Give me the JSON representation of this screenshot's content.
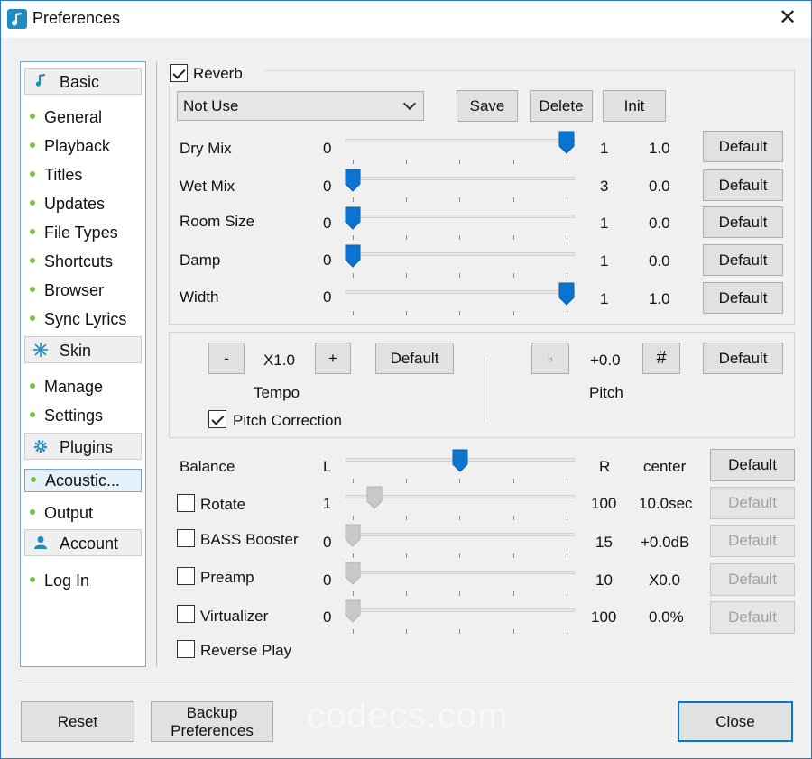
{
  "window": {
    "title": "Preferences",
    "close_glyph": "✕"
  },
  "sidebar": {
    "groups": [
      {
        "header": "Basic",
        "icon": "music-note-icon",
        "items": [
          "General",
          "Playback",
          "Titles",
          "Updates",
          "File Types",
          "Shortcuts",
          "Browser",
          "Sync Lyrics"
        ]
      },
      {
        "header": "Skin",
        "icon": "sparkle-icon",
        "items": [
          "Manage",
          "Settings"
        ]
      },
      {
        "header": "Plugins",
        "icon": "gear-icon",
        "items": [
          "Acoustic...",
          "Output"
        ]
      },
      {
        "header": "Account",
        "icon": "person-icon",
        "items": [
          "Log In"
        ]
      }
    ],
    "selected_item": "Acoustic..."
  },
  "reverb": {
    "label": "Reverb",
    "checked": true,
    "preset": "Not Use",
    "buttons": {
      "save": "Save",
      "delete": "Delete",
      "init": "Init"
    },
    "rows": [
      {
        "label": "Dry Mix",
        "min": "0",
        "max": "1",
        "value": "1.0",
        "level": 1.0,
        "button": "Default"
      },
      {
        "label": "Wet Mix",
        "min": "0",
        "max": "3",
        "value": "0.0",
        "level": 0.0,
        "button": "Default"
      },
      {
        "label": "Room Size",
        "min": "0",
        "max": "1",
        "value": "0.0",
        "level": 0.0,
        "button": "Default"
      },
      {
        "label": "Damp",
        "min": "0",
        "max": "1",
        "value": "0.0",
        "level": 0.0,
        "button": "Default"
      },
      {
        "label": "Width",
        "min": "0",
        "max": "1",
        "value": "1.0",
        "level": 1.0,
        "button": "Default"
      }
    ]
  },
  "tempo_pitch": {
    "tempo": {
      "minus": "-",
      "value": "X1.0",
      "plus": "+",
      "default": "Default",
      "label": "Tempo"
    },
    "pitch": {
      "flat": "♭",
      "value": "+0.0",
      "sharp": "#",
      "default": "Default",
      "label": "Pitch"
    },
    "pitch_correction": {
      "label": "Pitch Correction",
      "checked": true
    }
  },
  "effects": {
    "balance": {
      "label": "Balance",
      "min": "L",
      "max": "R",
      "value": "center",
      "level": 0.5,
      "button": "Default"
    },
    "rows": [
      {
        "label": "Rotate",
        "checked": false,
        "min": "1",
        "max": "100",
        "value": "10.0sec",
        "level": 0.1,
        "button": "Default"
      },
      {
        "label": "BASS Booster",
        "checked": false,
        "min": "0",
        "max": "15",
        "value": "+0.0dB",
        "level": 0.0,
        "button": "Default"
      },
      {
        "label": "Preamp",
        "checked": false,
        "min": "0",
        "max": "10",
        "value": "X0.0",
        "level": 0.0,
        "button": "Default"
      },
      {
        "label": "Virtualizer",
        "checked": false,
        "min": "0",
        "max": "100",
        "value": "0.0%",
        "level": 0.0,
        "button": "Default"
      }
    ],
    "reverse_play": {
      "label": "Reverse Play",
      "checked": false
    }
  },
  "footer": {
    "reset": "Reset",
    "backup_line1": "Backup",
    "backup_line2": "Preferences",
    "close": "Close",
    "watermark": "codecs.com"
  },
  "colors": {
    "accent": "#0078d7",
    "thumb_active": "#0a74d0",
    "thumb_disabled": "#c8c8c8",
    "sidebar_bullet": "#7ac143"
  }
}
